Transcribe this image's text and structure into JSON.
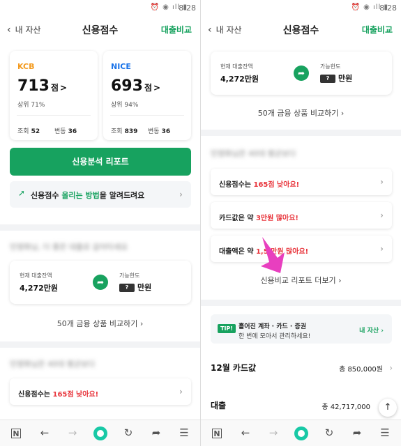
{
  "status": {
    "icons": "⏰ ◉ ıll ▮",
    "time": "8:28"
  },
  "header": {
    "back_label": "내 자산",
    "title": "신용점수",
    "right_label": "대출비교"
  },
  "scores": [
    {
      "agency": "KCB",
      "score": "713",
      "unit": "점",
      "rank": "상위 71%",
      "views_label": "조회",
      "views": "52",
      "change_label": "변동",
      "change": "36",
      "color": "#f39a1e"
    },
    {
      "agency": "NICE",
      "score": "693",
      "unit": "점",
      "rank": "상위 94%",
      "views_label": "조회",
      "views": "839",
      "change_label": "변동",
      "change": "36",
      "color": "#1a73e8"
    }
  ],
  "report_button": "신용분석 리포트",
  "tip_row": {
    "pre": "신용점수 ",
    "highlight": "올리는 방법",
    "post": "을 알려드려요"
  },
  "blurred": {
    "loan_heading": "민영화님, 더 좋은 대출로 갈아타세요",
    "peer_heading": "민영화님은 40대 평균보다"
  },
  "loan": {
    "balance_label": "현재 대출잔액",
    "balance": "4,272만원",
    "limit_label": "가능한도",
    "limit_badge": "?",
    "limit_unit": "만원"
  },
  "compare_link": "50개 금융 상품 비교하기",
  "issues": [
    {
      "pre": "신용점수는 ",
      "red": "165점 낮아요!",
      "post": ""
    },
    {
      "pre": "카드값은 약 ",
      "red": "3만원 많아요!",
      "post": ""
    },
    {
      "pre": "대출액은 약 ",
      "red": "1,5  만원 많아요!",
      "post": ""
    }
  ],
  "more_report": "신용비교 리포트 더보기",
  "tip_banner": {
    "badge": "TIP!",
    "line1": "흩어진 계좌 · 카드 · 증권",
    "line2": "한 번에 모아서 관리하세요!",
    "link": "내 자산"
  },
  "summary": [
    {
      "title": "12월 카드값",
      "value": "총 850,000원"
    },
    {
      "title": "대출",
      "value": "총 42,717,000"
    }
  ],
  "nav": {
    "n_label": "N",
    "back": "←",
    "forward": "→",
    "refresh": "↻",
    "share": "➦",
    "menu": "☰"
  },
  "colors": {
    "accent": "#17a25f",
    "alert": "#e8343b",
    "pointer": "#e83fbf"
  }
}
